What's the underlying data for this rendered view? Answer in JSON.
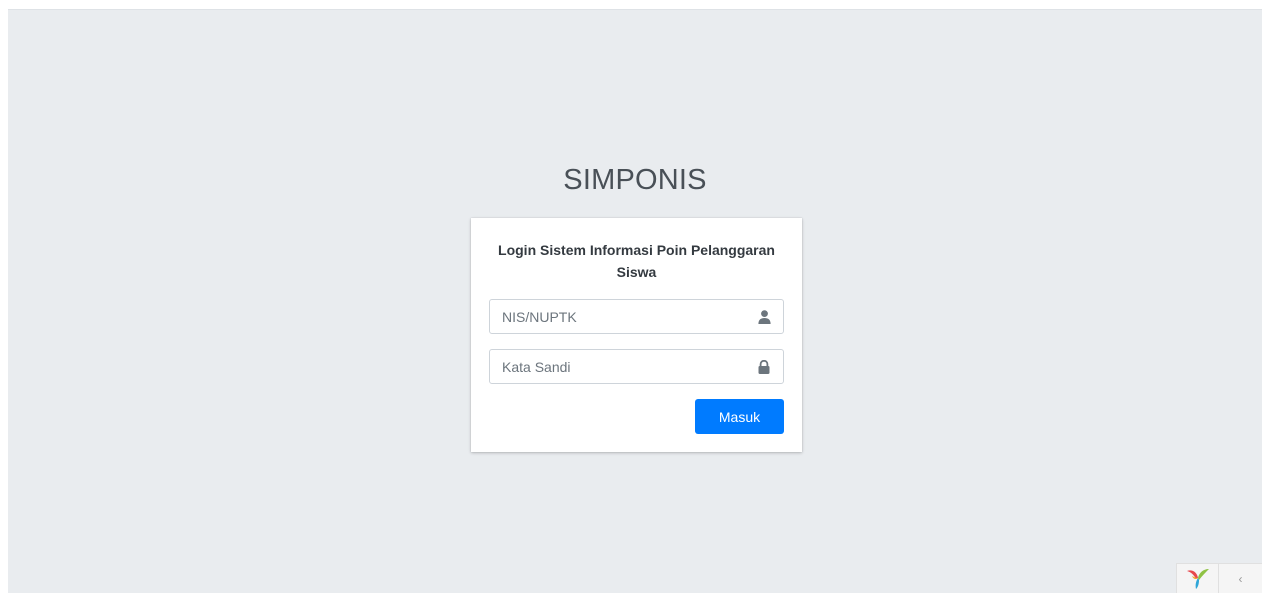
{
  "app": {
    "title": "SIMPONIS"
  },
  "login": {
    "heading": "Login Sistem Informasi Poin Pelanggaran Siswa",
    "username": {
      "placeholder": "NIS/NUPTK",
      "value": "",
      "icon": "user-icon"
    },
    "password": {
      "placeholder": "Kata Sandi",
      "value": "",
      "icon": "lock-icon"
    },
    "submit_label": "Masuk"
  },
  "debug_toolbar": {
    "logo_icon": "yii-logo-icon",
    "toggle_icon": "chevron-left-icon",
    "toggle_symbol": "‹"
  },
  "colors": {
    "background": "#e9ecef",
    "card": "#ffffff",
    "primary": "#007bff",
    "title_text": "#495057",
    "icon": "#6c757d"
  }
}
